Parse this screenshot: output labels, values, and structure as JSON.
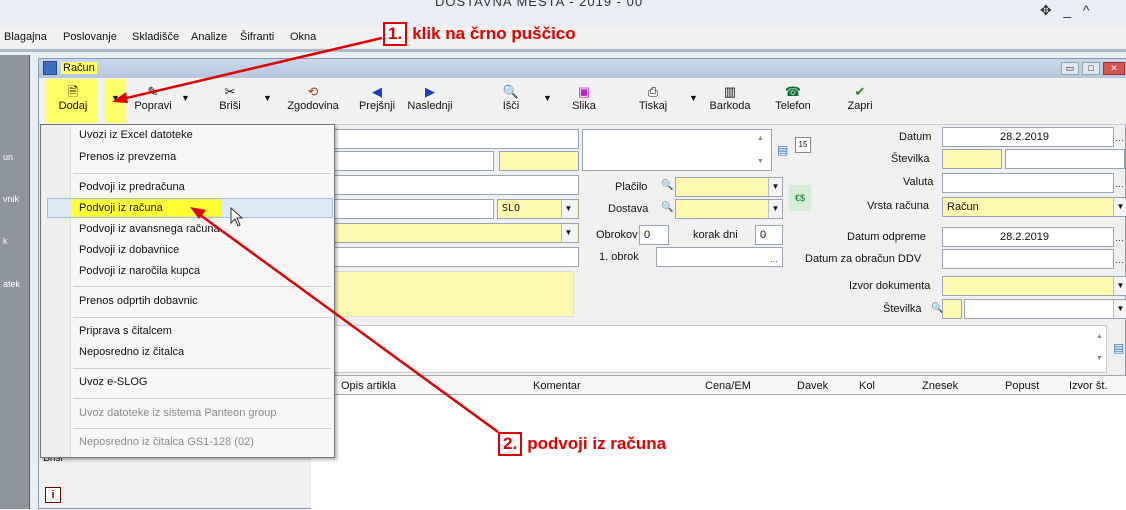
{
  "app": {
    "title": "DOSTAVNA MESTA - 2019 - 00"
  },
  "menubar": [
    "Blagajna",
    "Poslovanje",
    "Skladišče",
    "Analize",
    "Šifranti",
    "Okna"
  ],
  "left_panel": [
    "un",
    "vnik",
    "k",
    "atek"
  ],
  "window": {
    "title": "Račun"
  },
  "toolbar": {
    "dodaj": "Dodaj",
    "popravi": "Popravi",
    "brisi": "Briši",
    "zgodovina": "Zgodovina",
    "prejsnji": "Prejšnji",
    "naslednji": "Naslednji",
    "isci": "Išči",
    "slika": "Slika",
    "tiskaj": "Tiskaj",
    "barkoda": "Barkoda",
    "telefon": "Telefon",
    "zapri": "Zapri"
  },
  "form": {
    "datum_label": "Datum",
    "datum_value": "28.2.2019",
    "stevilka_label": "Številka",
    "valuta_label": "Valuta",
    "vrsta_label": "Vrsta računa",
    "vrsta_value": "Račun",
    "placilo_label": "Plačilo",
    "dostava_label": "Dostava",
    "drzava_value": "SLO",
    "obrokov_label": "Obrokov",
    "obrokov_value": "0",
    "korak_label": "korak dni",
    "korak_value": "0",
    "obrok1_label": "1. obrok",
    "datum_odpreme_label": "Datum odpreme",
    "datum_odpreme_value": "28.2.2019",
    "datum_ddv_label": "Datum za obračun DDV",
    "izvor_label": "Izvor dokumenta",
    "stevilka2_label": "Številka"
  },
  "grid": {
    "columns": [
      "Opis artikla",
      "Komentar",
      "Cena/EM",
      "Davek",
      "Kol",
      "Znesek",
      "Popust",
      "Izvor št."
    ]
  },
  "side_buttons": {
    "brisi": "Briši"
  },
  "menu": {
    "items": [
      "Uvozi iz Excel datoteke",
      "Prenos iz prevzema",
      "Podvoji iz predračuna",
      "Podvoji iz računa",
      "Podvoji iz avansnega računa",
      "Podvoji iz dobavnice",
      "Podvoji iz naročila kupca",
      "Prenos odprtih dobavnic",
      "Priprava s čitalcem",
      "Neposredno iz čitalca",
      "Uvoz e-SLOG",
      "Uvoz datoteke iz sistema Panteon group",
      "Neposredno iz čitalca GS1-128 (02)"
    ]
  },
  "annotations": {
    "a1_num": "1.",
    "a1_text": "klik na črno puščico",
    "a2_num": "2.",
    "a2_text": "podvoji iz računa"
  },
  "colors": {
    "highlight": "#ffff66",
    "annotation": "#e00000",
    "field_yellow": "#fff8b0"
  }
}
